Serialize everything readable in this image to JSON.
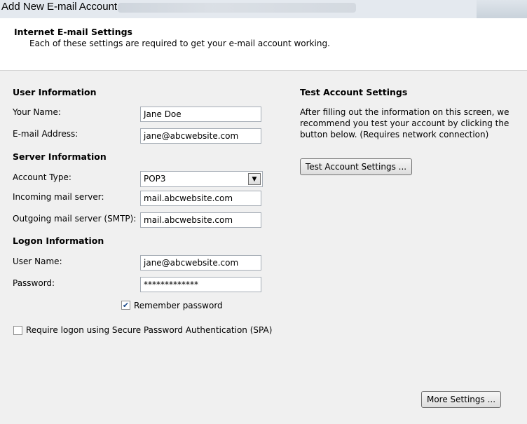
{
  "window": {
    "title": "Add New E-mail Account"
  },
  "header": {
    "title": "Internet E-mail Settings",
    "subtitle": "Each of these settings are required to get your e-mail account working."
  },
  "user_info": {
    "heading": "User Information",
    "name_label": "Your Name:",
    "name_value": "Jane Doe",
    "email_label": "E-mail Address:",
    "email_value": "jane@abcwebsite.com"
  },
  "server_info": {
    "heading": "Server Information",
    "account_type_label": "Account Type:",
    "account_type_value": "POP3",
    "incoming_label": "Incoming mail server:",
    "incoming_value": "mail.abcwebsite.com",
    "outgoing_label": "Outgoing mail server (SMTP):",
    "outgoing_value": "mail.abcwebsite.com"
  },
  "logon_info": {
    "heading": "Logon Information",
    "username_label": "User Name:",
    "username_value": "jane@abcwebsite.com",
    "password_label": "Password:",
    "password_value": "*************",
    "remember_label": "Remember password",
    "remember_checked": true,
    "spa_label": "Require logon using Secure Password Authentication (SPA)",
    "spa_checked": false
  },
  "test_settings": {
    "heading": "Test Account Settings",
    "line1": "After filling out the information on this screen, we",
    "line2": "recommend you test your account by clicking the",
    "line3": "button below. (Requires network connection)",
    "button_label": "Test Account Settings ..."
  },
  "footer": {
    "more_settings_label": "More Settings ..."
  },
  "icons": {
    "dropdown": "chevron-down-icon",
    "check": "checkmark-icon"
  },
  "colors": {
    "header_bg": "#ffffff",
    "panel_bg": "#f0f0f0",
    "check_color": "#1c4a8a"
  }
}
